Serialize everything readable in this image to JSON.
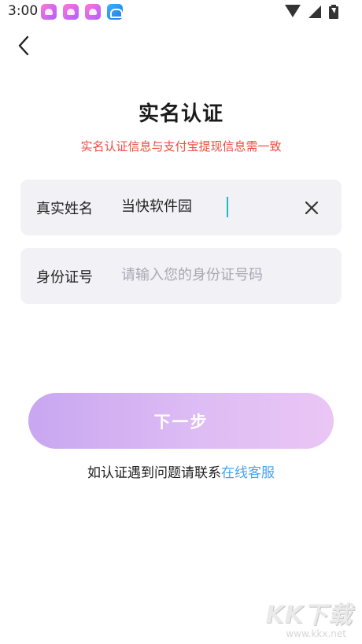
{
  "status_bar": {
    "time": "3:00",
    "icons": [
      "pink-app-icon",
      "pink-app-icon",
      "pink-app-icon",
      "blue-app-icon",
      "wifi-icon",
      "signal-icon",
      "battery-charging-icon"
    ]
  },
  "header": {
    "back_icon": "chevron-left-icon",
    "title": "实名认证",
    "subtitle": "实名认证信息与支付宝提现信息需一致"
  },
  "form": {
    "name_field": {
      "label": "真实姓名",
      "value": "当快软件园",
      "clear_icon": "close-icon"
    },
    "id_field": {
      "label": "身份证号",
      "placeholder": "请输入您的身份证号码",
      "value": ""
    }
  },
  "actions": {
    "next_label": "下一步"
  },
  "help": {
    "text": "如认证遇到问题请联系",
    "link_text": "在线客服"
  },
  "watermark": {
    "logo_text": "KK下载",
    "url": "www.kkx.net"
  },
  "colors": {
    "subtitle": "#ee4b3f",
    "field_bg": "#f2f1f6",
    "caret": "#1bbbc7",
    "link": "#4aa3ee",
    "button_gradient_start": "#c9a7f1",
    "button_gradient_end": "#eac6f5"
  }
}
